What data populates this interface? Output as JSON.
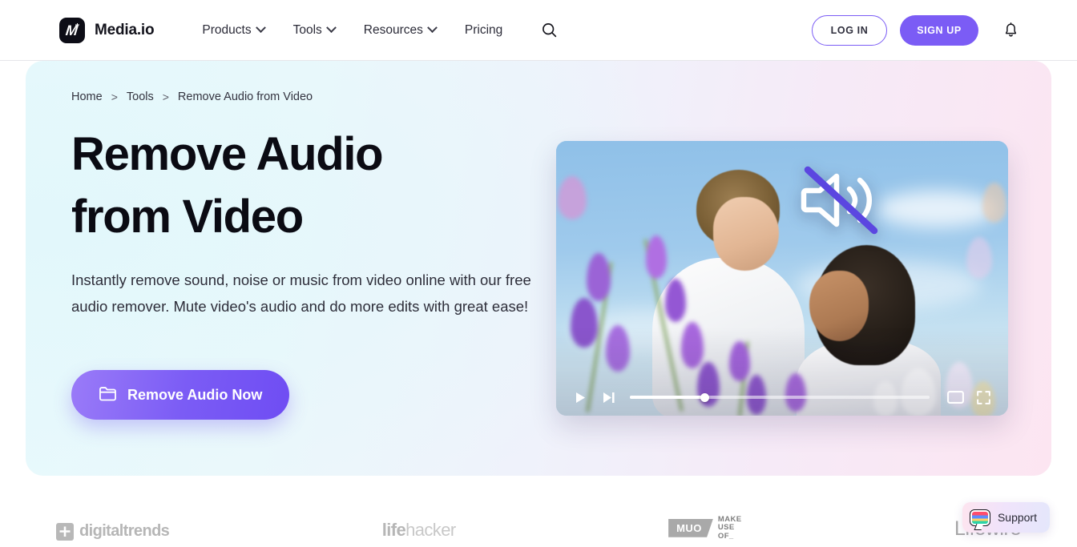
{
  "brand": {
    "name": "Media.io",
    "mark_letter": "M"
  },
  "nav": {
    "links": [
      {
        "label": "Products",
        "has_caret": true
      },
      {
        "label": "Tools",
        "has_caret": true
      },
      {
        "label": "Resources",
        "has_caret": true
      },
      {
        "label": "Pricing",
        "has_caret": false
      }
    ],
    "search_icon": "search-icon",
    "login_label": "LOG IN",
    "signup_label": "SIGN UP",
    "bell_icon": "bell-icon"
  },
  "hero": {
    "breadcrumb": [
      {
        "label": "Home"
      },
      {
        "label": "Tools"
      },
      {
        "label": "Remove Audio from Video"
      }
    ],
    "breadcrumb_separator": ">",
    "title_line1": "Remove Audio",
    "title_line2": "from Video",
    "subtitle": "Instantly remove sound, noise or music from video online with our free audio remover. Mute video's audio and do more edits with great ease!",
    "cta_label": "Remove Audio Now",
    "cta_icon": "folder-icon",
    "accent_color": "#7b5cf5",
    "gradient_start": "#e8fafc",
    "gradient_end": "#fce5f1"
  },
  "video": {
    "overlay_icon": "speaker-muted-icon",
    "controls": {
      "play_icon": "play-icon",
      "next_icon": "skip-next-icon",
      "pip_icon": "picture-in-picture-icon",
      "fullscreen_icon": "fullscreen-icon",
      "progress_percent": 25
    }
  },
  "logos": [
    {
      "name": "digitaltrends",
      "text": "digitaltrends"
    },
    {
      "name": "lifehacker",
      "bold": "life",
      "light": "hacker"
    },
    {
      "name": "makeuseof",
      "tag": "MUO",
      "line1": "MAKE",
      "line2": "USE",
      "line3": "OF_"
    },
    {
      "name": "lifewire",
      "text": "Lifewire"
    }
  ],
  "support": {
    "label": "Support",
    "icon": "chat-bubble-icon"
  }
}
